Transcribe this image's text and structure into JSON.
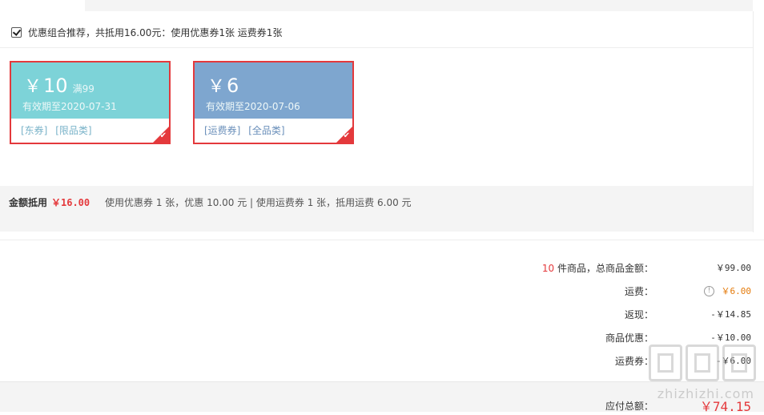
{
  "combo": {
    "checked": true,
    "text": "优惠组合推荐，共抵用16.00元：使用优惠券1张 运费券1张"
  },
  "coupons": [
    {
      "currency": "￥",
      "amount": "10",
      "condition": "满99",
      "validity": "有效期至2020-07-31",
      "tags": [
        "[东券]",
        "[限品类]"
      ],
      "selected": true,
      "color": "#7dd3d8"
    },
    {
      "currency": "￥",
      "amount": "6",
      "condition": "",
      "validity": "有效期至2020-07-06",
      "tags": [
        "[运费券]",
        "[全品类]"
      ],
      "selected": true,
      "color": "#7ea6cf"
    }
  ],
  "summary": {
    "label": "金额抵用",
    "amount": "￥16.00",
    "detail": "使用优惠券 1 张，优惠 10.00 元  | 使用运费券 1 张，抵用运费 6.00 元"
  },
  "totals": {
    "items_count": "10",
    "items_label": " 件商品，总商品金额：",
    "items_value": "￥99.00",
    "shipping_label": "运费：",
    "shipping_value": "￥6.00",
    "cashback_label": "返现：",
    "cashback_value": "-￥14.85",
    "discount_label": "商品优惠：",
    "discount_value": "-￥10.00",
    "shipcoupon_label": "运费券：",
    "shipcoupon_value": "-￥6.00",
    "payable_label": "应付总额：",
    "payable_value": "￥74.15"
  },
  "watermark": {
    "text": "zhizhizhi.com"
  },
  "colors": {
    "accent_red": "#e4393c",
    "shipping_orange": "#e47a0a",
    "coupon_teal": "#7dd3d8",
    "coupon_blue": "#7ea6cf"
  }
}
